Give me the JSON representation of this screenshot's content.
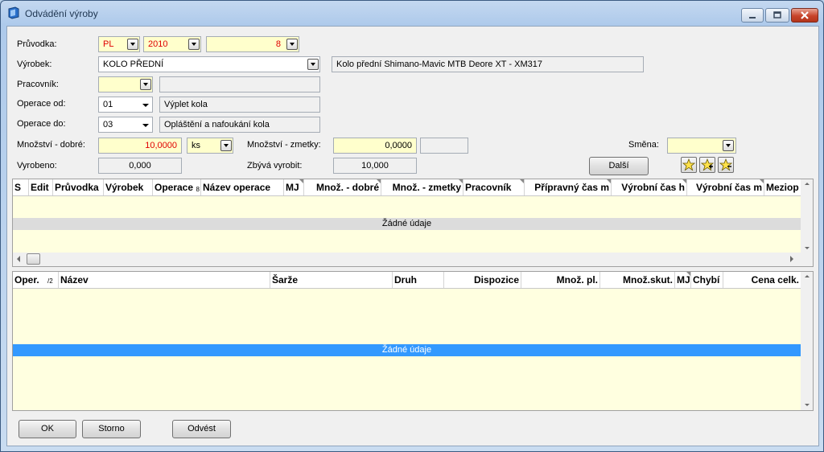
{
  "window": {
    "title": "Odvádění výroby"
  },
  "form": {
    "pruvodka": {
      "label": "Průvodka:",
      "rada": "PL",
      "rok": "2010",
      "cislo": "8"
    },
    "vyrobek": {
      "label": "Výrobek:",
      "value": "KOLO PŘEDNÍ",
      "description": "Kolo přední Shimano-Mavic MTB Deore XT - XM317"
    },
    "pracovnik": {
      "label": "Pracovník:",
      "value": "",
      "name": ""
    },
    "operace_od": {
      "label": "Operace od:",
      "value": "01",
      "name": "Výplet kola"
    },
    "operace_do": {
      "label": "Operace do:",
      "value": "03",
      "name": "Opláštění a nafoukání kola"
    },
    "mnozstvi_dobre": {
      "label": "Množství - dobré:",
      "value": "10,0000",
      "unit": "ks"
    },
    "mnozstvi_zmetky": {
      "label": "Množství - zmetky:",
      "value": "0,0000",
      "extra": ""
    },
    "smena": {
      "label": "Směna:",
      "value": ""
    },
    "vyrobeno": {
      "label": "Vyrobeno:",
      "value": "0,000"
    },
    "zbyva": {
      "label": "Zbývá vyrobit:",
      "value": "10,000"
    },
    "dalsi_label": "Další"
  },
  "grid1": {
    "columns": [
      "S",
      "Edit",
      "Průvodka",
      "Výrobek",
      "Operace",
      "Název operace",
      "MJ",
      "Množ. - dobré",
      "Množ. - zmetky",
      "Pracovník",
      "Přípravný čas m",
      "Výrobní čas h",
      "Výrobní čas m",
      "Meziop"
    ],
    "sort_marker": "8",
    "empty_text": "Žádné údaje"
  },
  "grid2": {
    "columns": [
      "Oper.",
      "Název",
      "Šarže",
      "Druh",
      "Dispozice",
      "Množ. pl.",
      "Množ.skut.",
      "MJ",
      "Chybí",
      "Cena celk."
    ],
    "sort_marker": "/2",
    "empty_text": "Žádné údaje"
  },
  "buttons": {
    "ok": "OK",
    "storno": "Storno",
    "odvest": "Odvést"
  },
  "colors": {
    "selection_blue": "#3399ff",
    "empty_gray": "#dcdcdc",
    "required_yellow": "#ffffcc",
    "red_value": "#e00000"
  }
}
